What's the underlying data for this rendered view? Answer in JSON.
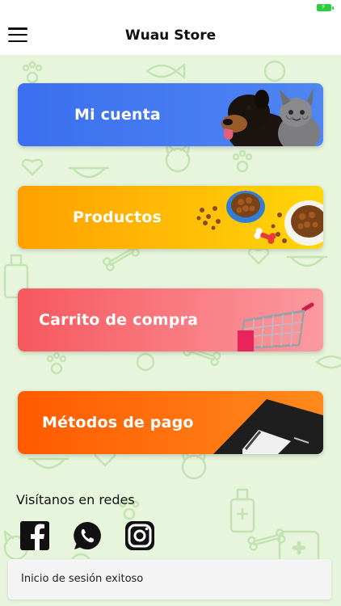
{
  "app": {
    "title": "Wuau Store"
  },
  "menu": {
    "items": [
      {
        "label": "Mi cuenta"
      },
      {
        "label": "Productos"
      },
      {
        "label": "Carrito de compra"
      },
      {
        "label": "Métodos de pago"
      }
    ]
  },
  "social": {
    "title": "Visítanos en redes",
    "icons": [
      "facebook-icon",
      "whatsapp-icon",
      "instagram-icon"
    ]
  },
  "snackbar": {
    "message": "Inicio de sesión exitoso"
  },
  "colors": {
    "background": "#e6f5dc",
    "account_card": "#3b6ff0",
    "products_card": "#ffb300",
    "cart_card": "#f6585e",
    "payment_card": "#ff5a00",
    "battery": "#2ecc40"
  }
}
